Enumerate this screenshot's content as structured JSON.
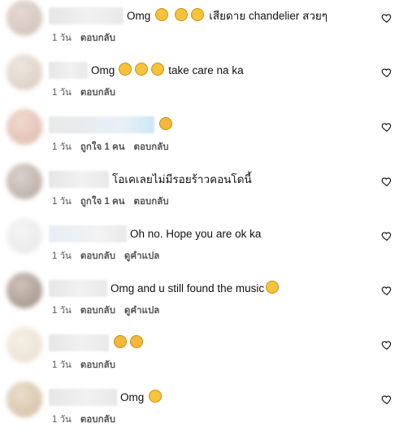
{
  "comments": [
    {
      "text_before": "Omg",
      "emojis_before": [
        "scream-emoji",
        "scream-emoji",
        "scream-emoji"
      ],
      "text_after": "เสียดาย chandelier สวยๆ",
      "time": "1 วัน",
      "likes": "",
      "reply": "ตอบกลับ",
      "translate": ""
    },
    {
      "text_before": "Omg",
      "emojis_before": [
        "scream-emoji",
        "scream-emoji",
        "scream-emoji"
      ],
      "text_after": "take care na ka",
      "time": "1 วัน",
      "likes": "",
      "reply": "ตอบกลับ",
      "translate": ""
    },
    {
      "text_before": "",
      "emojis_before": [
        "sad-emoji"
      ],
      "text_after": "",
      "time": "1 วัน",
      "likes": "ถูกใจ 1 คน",
      "reply": "ตอบกลับ",
      "translate": ""
    },
    {
      "text_before": "โอเคเลยไม่มีรอยร้าวคอนโดนี้",
      "emojis_before": [],
      "text_after": "",
      "time": "1 วัน",
      "likes": "ถูกใจ 1 คน",
      "reply": "ตอบกลับ",
      "translate": ""
    },
    {
      "text_before": "Oh no. Hope you are ok ka",
      "emojis_before": [],
      "text_after": "",
      "time": "1 วัน",
      "likes": "",
      "reply": "ตอบกลับ",
      "translate": "ดูคำแปล"
    },
    {
      "text_before": "Omg and u still found the music",
      "emojis_before": [
        "grin-sweat-emoji"
      ],
      "text_after": "",
      "time": "1 วัน",
      "likes": "",
      "reply": "ตอบกลับ",
      "translate": "ดูคำแปล"
    },
    {
      "text_before": "",
      "emojis_before": [
        "sad-emoji",
        "sad-emoji"
      ],
      "text_after": "",
      "time": "1 วัน",
      "likes": "",
      "reply": "ตอบกลับ",
      "translate": ""
    },
    {
      "text_before": "Omg",
      "emojis_before": [
        "shocked-emoji"
      ],
      "text_after": "",
      "time": "1 วัน",
      "likes": "",
      "reply": "ตอบกลับ",
      "translate": ""
    }
  ],
  "icons": {
    "like": "heart-icon"
  }
}
